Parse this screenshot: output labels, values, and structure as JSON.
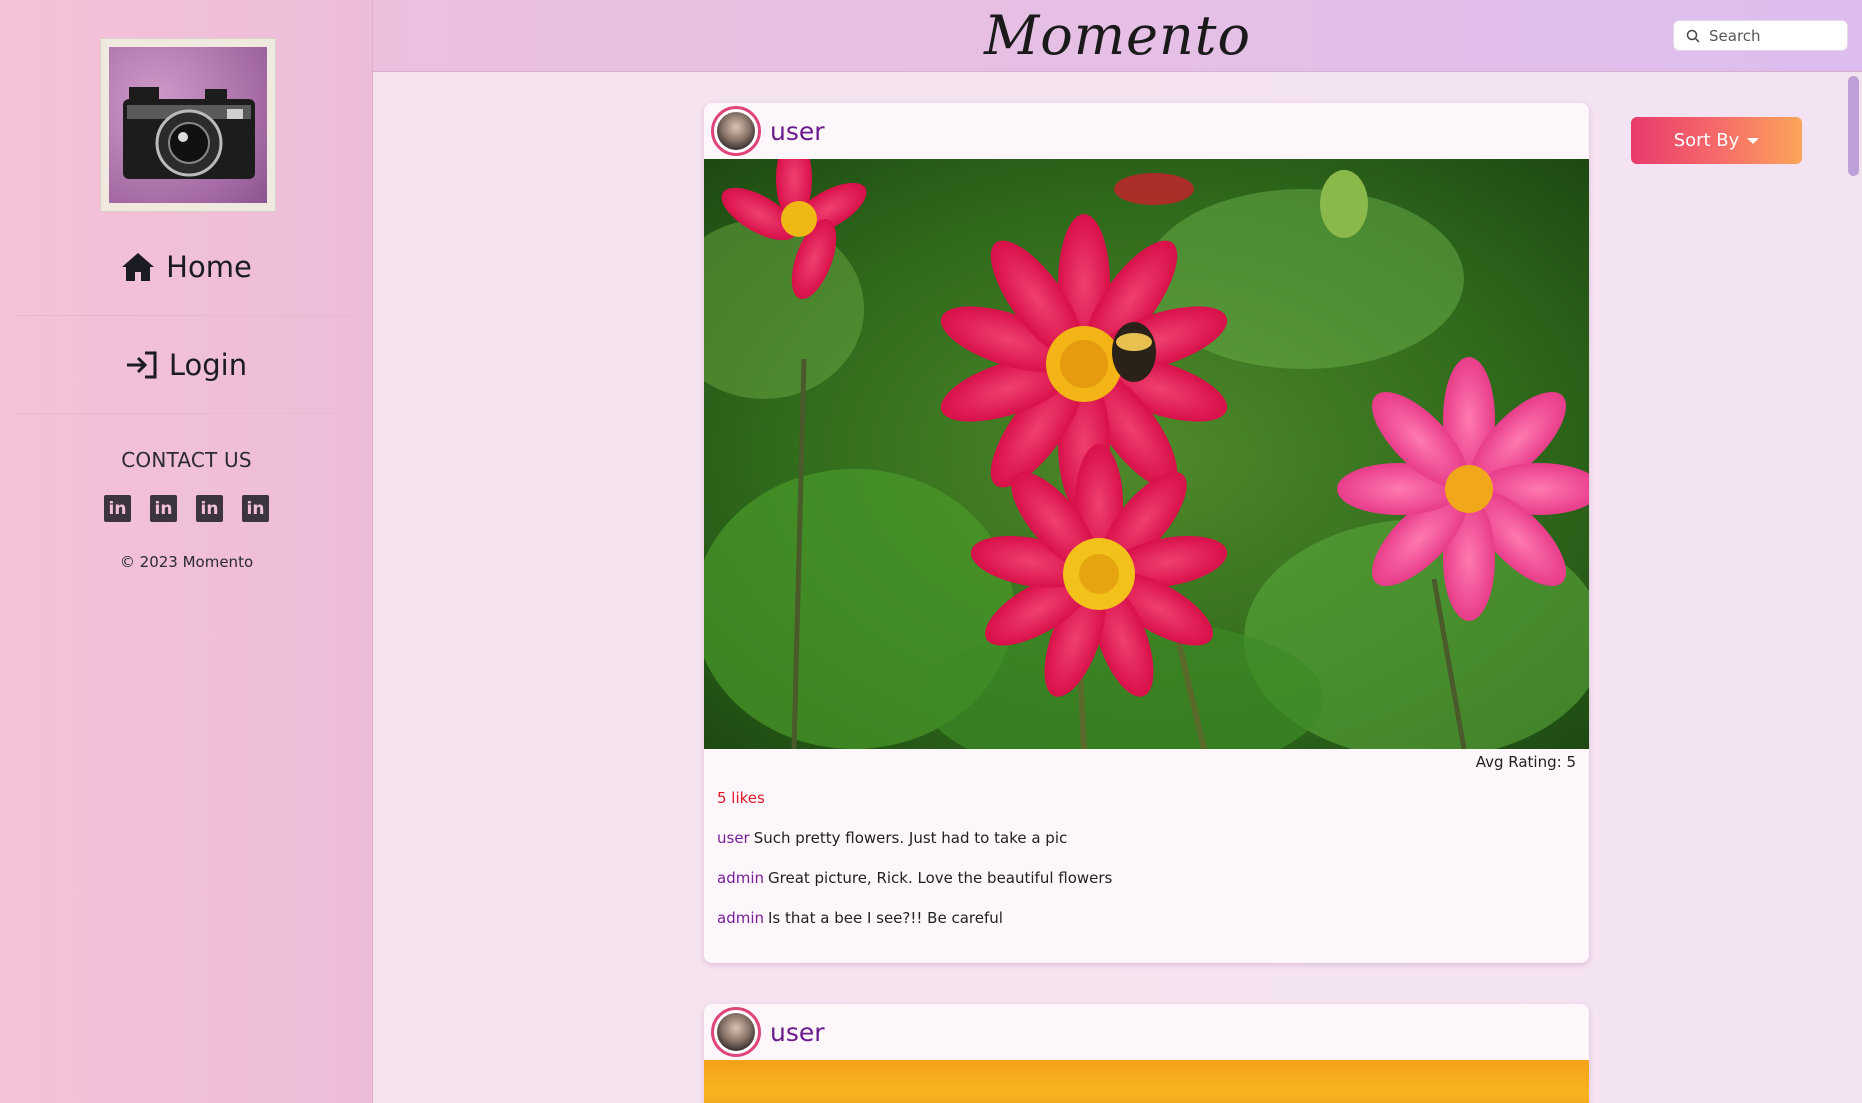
{
  "header": {
    "brand": "Momento",
    "search_placeholder": "Search"
  },
  "sidebar": {
    "logo_icon": "camera-logo",
    "nav": [
      {
        "label": "Home",
        "icon": "home-icon"
      },
      {
        "label": "Login",
        "icon": "login-icon"
      }
    ],
    "contact_title": "CONTACT US",
    "social": [
      {
        "icon": "linkedin-icon",
        "glyph": "in"
      },
      {
        "icon": "linkedin-icon",
        "glyph": "in"
      },
      {
        "icon": "linkedin-icon",
        "glyph": "in"
      },
      {
        "icon": "linkedin-icon",
        "glyph": "in"
      }
    ],
    "copyright": "2023 Momento"
  },
  "toolbar": {
    "sort_label": "Sort By"
  },
  "posts": [
    {
      "username": "user",
      "avg_rating": "Avg Rating: 5",
      "likes": "5 likes",
      "comments": [
        {
          "user": "user",
          "text": "Such pretty flowers. Just had to take a pic"
        },
        {
          "user": "admin",
          "text": "Great picture, Rick. Love the beautiful flowers"
        },
        {
          "user": "admin",
          "text": "Is that a bee I see?!! Be careful"
        }
      ]
    },
    {
      "username": "user"
    }
  ],
  "colors": {
    "accent_purple": "#6a1a8a",
    "likes_red": "#e01c2c",
    "sort_gradient_start": "#e73a6c",
    "sort_gradient_end": "#fba55a"
  }
}
